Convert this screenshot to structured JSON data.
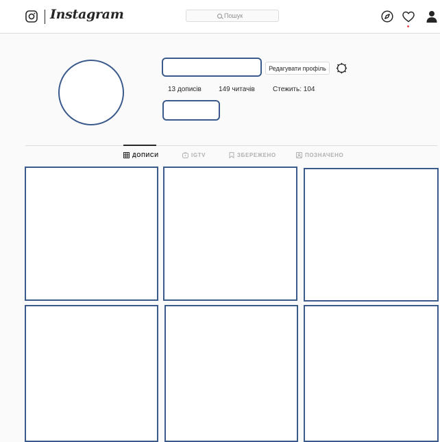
{
  "header": {
    "logo_text": "Instagram",
    "search": {
      "placeholder": "Пошук"
    }
  },
  "profile": {
    "edit_button_label": "Редагувати профіль",
    "stats": {
      "posts": "13 дописів",
      "followers": "149 читачів",
      "following": "Стежить: 104"
    }
  },
  "tabs": [
    {
      "label": "ДОПИСИ",
      "icon": "grid-icon",
      "active": true
    },
    {
      "label": "IGTV",
      "icon": "igtv-icon",
      "active": false
    },
    {
      "label": "ЗБЕРЕЖЕНО",
      "icon": "bookmark-icon",
      "active": false
    },
    {
      "label": "ПОЗНАЧЕНО",
      "icon": "tagged-icon",
      "active": false
    }
  ],
  "colors": {
    "placeholder_outline": "#3a5a8c",
    "notification_dot": "#ed4956",
    "border": "#dbdbdb",
    "background": "#fafafa"
  }
}
